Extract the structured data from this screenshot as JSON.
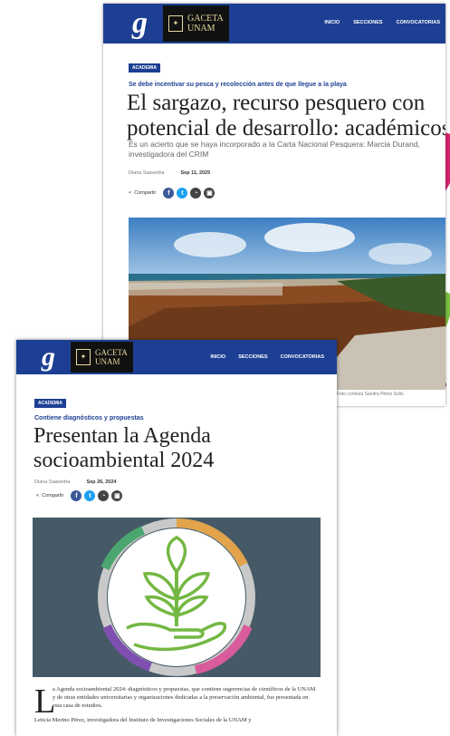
{
  "back_article": {
    "header": {
      "logo_letter": "g",
      "brand_line1": "GACETA",
      "brand_line2": "UNAM",
      "nav": [
        "INICIO",
        "SECCIONES",
        "CONVOCATORIAS"
      ]
    },
    "category": "ACADEMIA",
    "kicker": "Se debe incentivar su pesca y recolección antes de que llegue a la playa",
    "title": "El sargazo, recurso pesquero con potencial de desarrollo: académicos",
    "dek": "Es un acierto que se haya incorporado a la Carta Nacional Pesquera: Marcia Durand, investigadora del CRIM",
    "author": "Diana Saavedra",
    "date": "Sep 11, 2025",
    "share_label": "Compartir",
    "photo_credit": "Foto cortesía Sandra Pérez Solís"
  },
  "front_article": {
    "header": {
      "logo_letter": "g",
      "brand_line1": "GACETA",
      "brand_line2": "UNAM",
      "nav": [
        "INICIO",
        "SECCIONES",
        "CONVOCATORIAS"
      ]
    },
    "category": "ACADEMIA",
    "kicker": "Contiene diagnósticos y propuestas",
    "title": "Presentan la Agenda socioambiental 2024",
    "author": "Diana Saavedra",
    "date": "Sep 26, 2024",
    "share_label": "Compartir",
    "dropcap": "L",
    "body_p1": "a Agenda socioambiental 2024: diagnósticos y propuestas, que contiene sugerencias de científicos de la UNAM y de otras entidades universitarias y organizaciones dedicadas a la preservación ambiental, fue presentada en esta casa de estudios.",
    "body_p2": "Leticia Merino Pérez, investigadora del Instituto de Investigaciones Sociales de la UNAM y"
  },
  "colors": {
    "header_blue": "#1d3f93",
    "facebook": "#3b5998",
    "twitter": "#1da1f2",
    "dark_share": "#444444",
    "illustration_bg": "#455a66",
    "leaf_green": "#74b843"
  }
}
